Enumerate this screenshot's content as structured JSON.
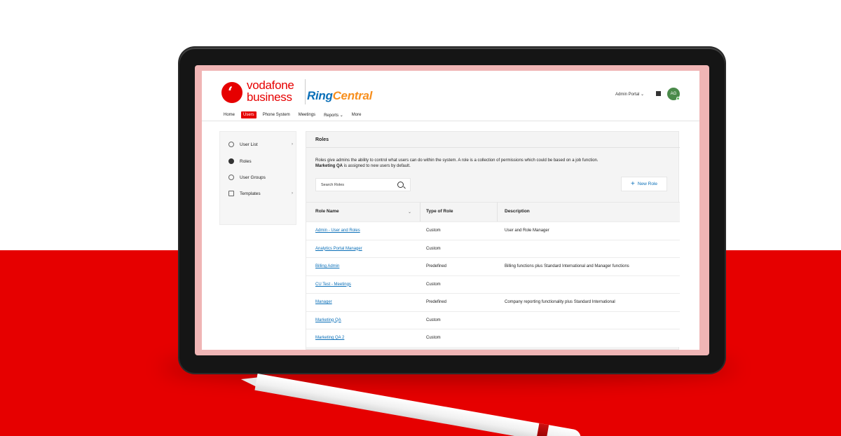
{
  "brand": {
    "vodafone_line1": "vodafone",
    "vodafone_line2": "business",
    "ringcentral_part1": "Ring",
    "ringcentral_part2": "Central",
    "accent_color": "#e60000",
    "link_color": "#0a6fb8"
  },
  "header": {
    "admin_portal": "Admin Portal ⌄",
    "avatar_initials": "AG"
  },
  "nav": {
    "items": [
      {
        "label": "Home",
        "active": false
      },
      {
        "label": "Users",
        "active": true
      },
      {
        "label": "Phone System",
        "active": false
      },
      {
        "label": "Meetings",
        "active": false
      },
      {
        "label": "Reports ⌄",
        "active": false
      },
      {
        "label": "More",
        "active": false
      }
    ]
  },
  "sidebar": {
    "items": [
      {
        "label": "User List",
        "icon": "user-icon",
        "chevron": "›"
      },
      {
        "label": "Roles",
        "icon": "roles-icon"
      },
      {
        "label": "User Groups",
        "icon": "user-groups-icon"
      },
      {
        "label": "Templates",
        "icon": "templates-icon",
        "chevron": "›"
      }
    ]
  },
  "main": {
    "title": "Roles",
    "description_part1": "Roles give admins the ability to control what users can do within the system. A role is a collection of permissions which could be based on a job function.",
    "description_bold": "Marketing QA",
    "description_part2": " is assigned to new users by default.",
    "search_placeholder": "Search Roles",
    "new_role_label": "New Role",
    "table": {
      "headers": [
        "Role Name",
        "Type of Role",
        "Description"
      ],
      "rows": [
        {
          "name": "Admin - User and Roles",
          "type": "Custom",
          "description": "User and Role Manager"
        },
        {
          "name": "Analytics Portal Manager",
          "type": "Custom",
          "description": ""
        },
        {
          "name": "Billing Admin",
          "type": "Predefined",
          "description": "Billing functions plus Standard International and Manager functions"
        },
        {
          "name": "CU Test - Meetings",
          "type": "Custom",
          "description": ""
        },
        {
          "name": "Manager",
          "type": "Predefined",
          "description": "Company reporting functionality plus Standard International"
        },
        {
          "name": "Marketing QA",
          "type": "Custom",
          "description": ""
        },
        {
          "name": "Marketing QA 2",
          "type": "Custom",
          "description": ""
        }
      ]
    }
  }
}
